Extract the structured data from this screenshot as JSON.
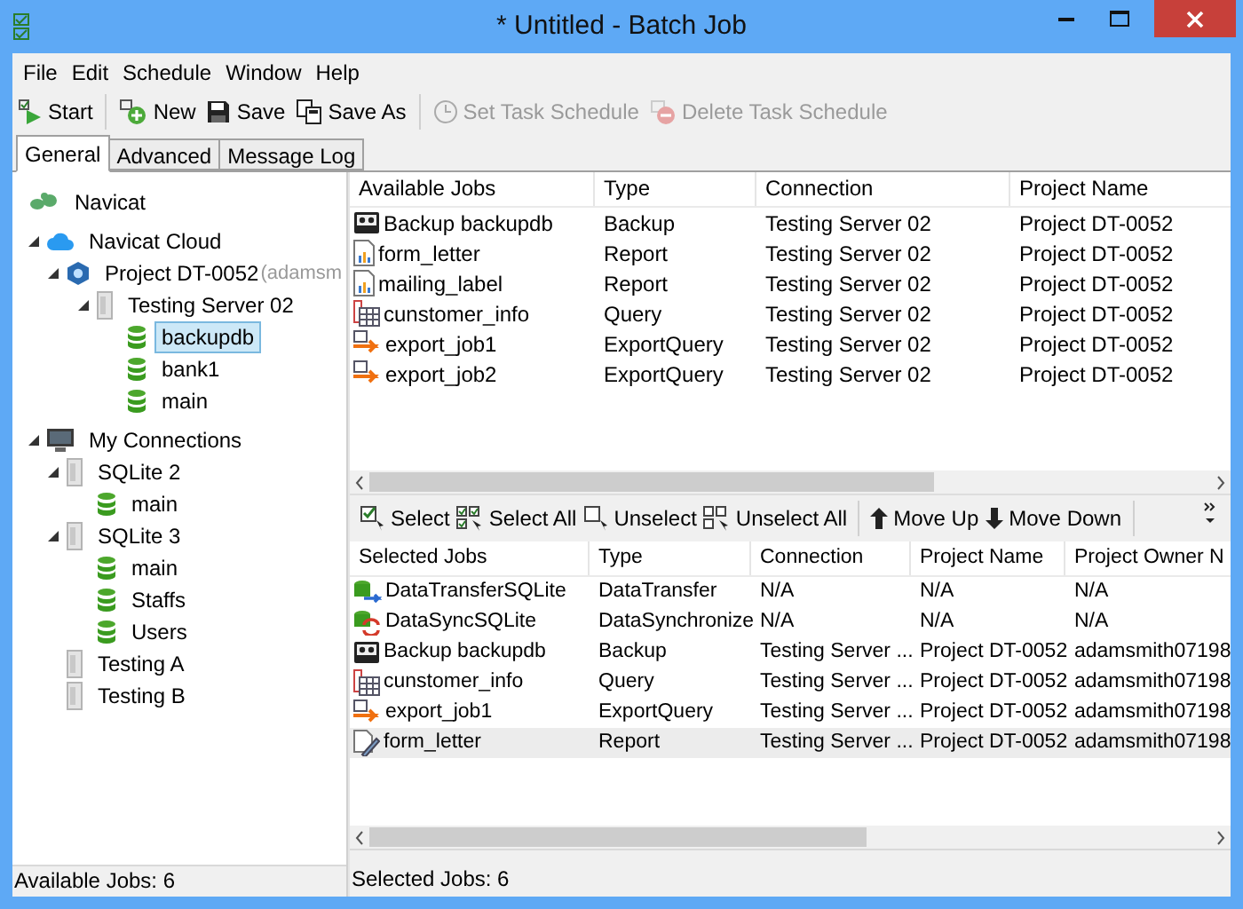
{
  "window": {
    "title": "* Untitled - Batch Job"
  },
  "menu": [
    "File",
    "Edit",
    "Schedule",
    "Window",
    "Help"
  ],
  "toolbar": [
    {
      "kind": "start",
      "label": "Start",
      "disabled": false
    },
    {
      "kind": "sep"
    },
    {
      "kind": "new",
      "label": "New",
      "disabled": false
    },
    {
      "kind": "save",
      "label": "Save",
      "disabled": false
    },
    {
      "kind": "saveas",
      "label": "Save As",
      "disabled": false
    },
    {
      "kind": "sep"
    },
    {
      "kind": "clock",
      "label": "Set Task Schedule",
      "disabled": true
    },
    {
      "kind": "delete",
      "label": "Delete Task Schedule",
      "disabled": true
    }
  ],
  "tabs": [
    {
      "label": "General",
      "selected": true
    },
    {
      "label": "Advanced",
      "selected": false
    },
    {
      "label": "Message Log",
      "selected": false
    }
  ],
  "tree": [
    {
      "kind": "navicat",
      "label": "Navicat"
    },
    {
      "kind": "cloud",
      "label": "Navicat Cloud",
      "expanded": true,
      "children": [
        {
          "kind": "project",
          "label": "Project DT-0052",
          "owner": "(adamsm",
          "expanded": true,
          "children": [
            {
              "kind": "server",
              "label": "Testing Server 02",
              "expanded": true,
              "children": [
                {
                  "kind": "db",
                  "label": "backupdb",
                  "selected": true
                },
                {
                  "kind": "db",
                  "label": "bank1",
                  "selected": false
                },
                {
                  "kind": "db",
                  "label": "main",
                  "selected": false
                }
              ]
            }
          ]
        }
      ]
    },
    {
      "kind": "computer",
      "label": "My Connections",
      "expanded": true,
      "children": [
        {
          "kind": "server",
          "label": "SQLite 2",
          "expanded": true,
          "children": [
            {
              "kind": "db",
              "label": "main",
              "selected": false
            }
          ]
        },
        {
          "kind": "server",
          "label": "SQLite 3",
          "expanded": true,
          "children": [
            {
              "kind": "db",
              "label": "main",
              "selected": false
            },
            {
              "kind": "db",
              "label": "Staffs",
              "selected": false
            },
            {
              "kind": "db",
              "label": "Users",
              "selected": false
            }
          ]
        },
        {
          "kind": "server",
          "label": "Testing A"
        },
        {
          "kind": "server",
          "label": "Testing B"
        }
      ]
    }
  ],
  "left_status": "Available Jobs: 6",
  "available_jobs": {
    "columns": [
      "Available Jobs",
      "Type",
      "Connection",
      "Project Name"
    ],
    "rows": [
      {
        "kind": "backup",
        "cells": [
          "Backup backupdb",
          "Backup",
          "Testing Server 02",
          "Project DT-0052"
        ]
      },
      {
        "kind": "report",
        "cells": [
          "form_letter",
          "Report",
          "Testing Server 02",
          "Project DT-0052"
        ]
      },
      {
        "kind": "report",
        "cells": [
          "mailing_label",
          "Report",
          "Testing Server 02",
          "Project DT-0052"
        ]
      },
      {
        "kind": "query",
        "cells": [
          "cunstomer_info",
          "Query",
          "Testing Server 02",
          "Project DT-0052"
        ]
      },
      {
        "kind": "export",
        "cells": [
          "export_job1",
          "ExportQuery",
          "Testing Server 02",
          "Project DT-0052"
        ]
      },
      {
        "kind": "export",
        "cells": [
          "export_job2",
          "ExportQuery",
          "Testing Server 02",
          "Project DT-0052"
        ]
      }
    ]
  },
  "job_toolbar": [
    {
      "kind": "select",
      "label": "Select"
    },
    {
      "kind": "selectall",
      "label": "Select All"
    },
    {
      "kind": "unselect",
      "label": "Unselect"
    },
    {
      "kind": "unselectall",
      "label": "Unselect All"
    },
    {
      "kind": "sep"
    },
    {
      "kind": "up",
      "label": "Move Up"
    },
    {
      "kind": "down",
      "label": "Move Down"
    },
    {
      "kind": "sep"
    }
  ],
  "selected_jobs": {
    "columns": [
      "Selected Jobs",
      "Type",
      "Connection",
      "Project Name",
      "Project Owner N"
    ],
    "rows": [
      {
        "kind": "transfer",
        "selected": false,
        "cells": [
          "DataTransferSQLite",
          "DataTransfer",
          "N/A",
          "N/A",
          "N/A"
        ]
      },
      {
        "kind": "sync",
        "selected": false,
        "cells": [
          "DataSyncSQLite",
          "DataSynchronize",
          "N/A",
          "N/A",
          "N/A"
        ]
      },
      {
        "kind": "backup",
        "selected": false,
        "cells": [
          "Backup backupdb",
          "Backup",
          "Testing Server ...",
          "Project DT-0052",
          "adamsmith07198"
        ]
      },
      {
        "kind": "query",
        "selected": false,
        "cells": [
          "cunstomer_info",
          "Query",
          "Testing Server ...",
          "Project DT-0052",
          "adamsmith07198"
        ]
      },
      {
        "kind": "export",
        "selected": false,
        "cells": [
          "export_job1",
          "ExportQuery",
          "Testing Server ...",
          "Project DT-0052",
          "adamsmith07198"
        ]
      },
      {
        "kind": "reportdone",
        "selected": true,
        "cells": [
          "form_letter",
          "Report",
          "Testing Server ...",
          "Project DT-0052",
          "adamsmith07198"
        ]
      }
    ]
  },
  "right_status": "Selected Jobs: 6"
}
